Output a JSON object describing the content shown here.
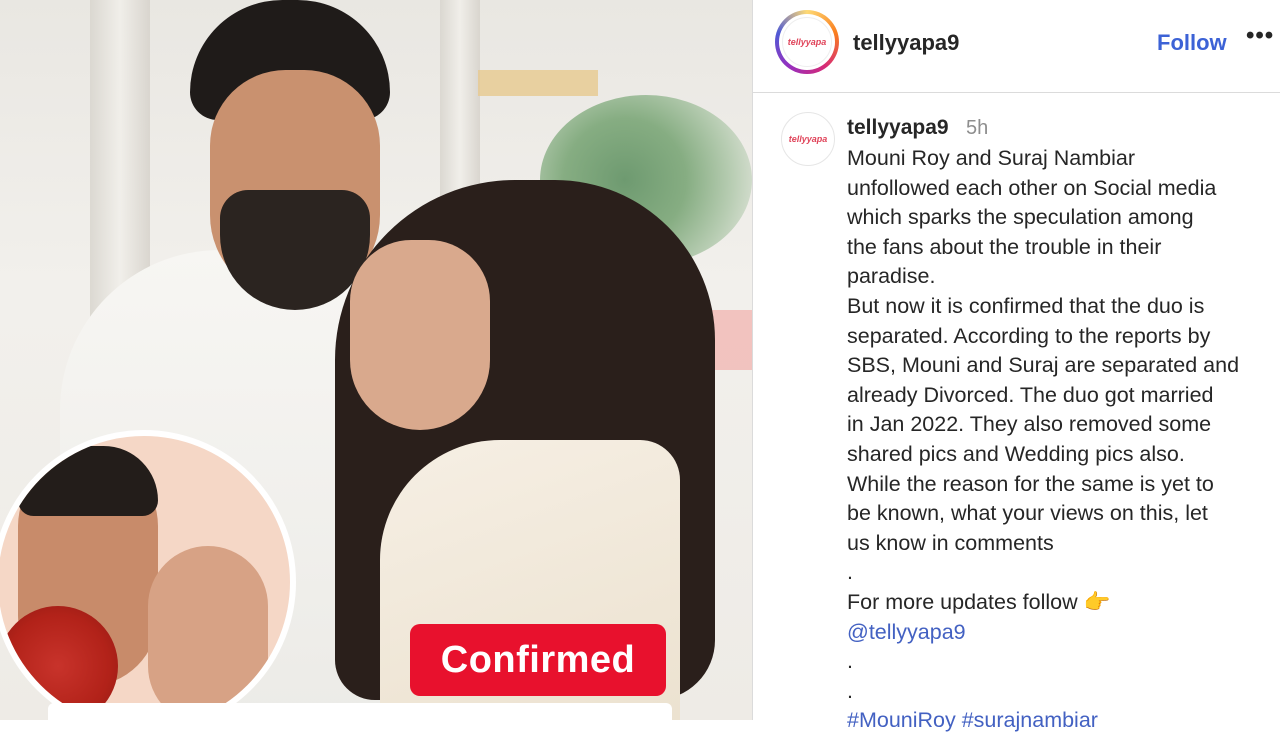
{
  "post_image": {
    "badge_text": "Confirmed"
  },
  "header": {
    "username": "tellyyapa9",
    "follow_label": "Follow",
    "more_icon": "more-dots-icon",
    "logo_text": "tellyyapa"
  },
  "comment": {
    "username": "tellyyapa9",
    "time": "5h",
    "lines": [
      "Mouni Roy and Suraj Nambiar",
      "unfollowed each other on Social media",
      "which sparks the speculation among",
      "the fans about the trouble in their",
      "paradise.",
      "But now it is confirmed that the duo is",
      "separated. According to the reports by",
      "SBS, Mouni and Suraj are separated and",
      "already Divorced. The duo got married",
      "in Jan 2022. They also removed some",
      "shared pics and Wedding pics also.",
      "While the reason for the same is yet to",
      "be known, what your views on this, let",
      "us know in comments",
      ".",
      "For more updates follow 👉",
      "@tellyyapa9",
      ".",
      ".",
      "#MouniRoy #surajnambiar"
    ]
  },
  "colors": {
    "follow": "#3c62d6",
    "badge": "#e8112d",
    "link": "#4361c2"
  }
}
